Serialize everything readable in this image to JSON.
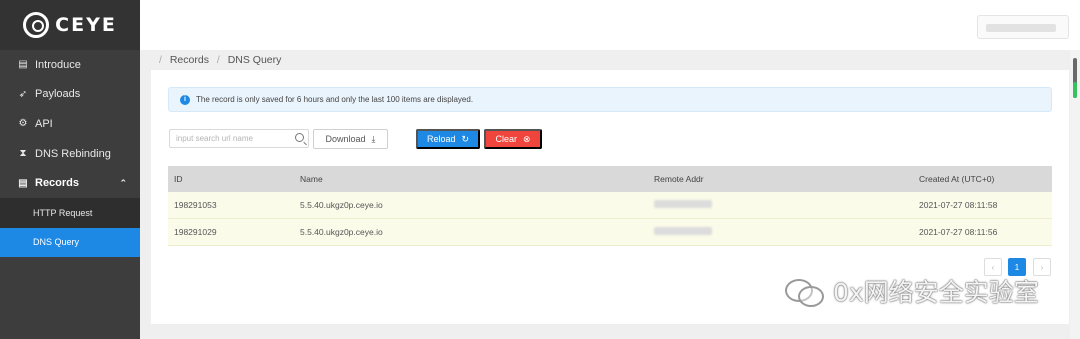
{
  "brand": {
    "name": "CEYE"
  },
  "sidebar": {
    "items": [
      {
        "label": "Introduce",
        "icon": "document-icon"
      },
      {
        "label": "Payloads",
        "icon": "rocket-icon"
      },
      {
        "label": "API",
        "icon": "api-icon"
      },
      {
        "label": "DNS Rebinding",
        "icon": "hourglass-icon"
      },
      {
        "label": "Records",
        "icon": "records-icon",
        "expanded": true
      }
    ],
    "sub_items": [
      {
        "label": "HTTP Request",
        "active": false
      },
      {
        "label": "DNS Query",
        "active": true
      }
    ]
  },
  "breadcrumb": {
    "root": "Records",
    "current": "DNS Query"
  },
  "notice": {
    "text": "The record is only saved for 6 hours and only the last 100 items are displayed."
  },
  "toolbar": {
    "search_placeholder": "input search url name",
    "download_label": "Download",
    "reload_label": "Reload",
    "clear_label": "Clear"
  },
  "table": {
    "columns": [
      "ID",
      "Name",
      "Remote Addr",
      "Created At (UTC+0)"
    ],
    "rows": [
      {
        "id": "198291053",
        "name": "5.5.40.ukgz0p.ceye.io",
        "created": "2021-07-27 08:11:58"
      },
      {
        "id": "198291029",
        "name": "5.5.40.ukgz0p.ceye.io",
        "created": "2021-07-27 08:11:56"
      }
    ]
  },
  "pagination": {
    "current": "1",
    "prev": "‹",
    "next": "›"
  },
  "watermark": {
    "text": "0x网络安全实验室"
  },
  "colors": {
    "accent": "#1e88e5",
    "danger": "#f0453c",
    "sidebar": "#3d3d3d"
  }
}
